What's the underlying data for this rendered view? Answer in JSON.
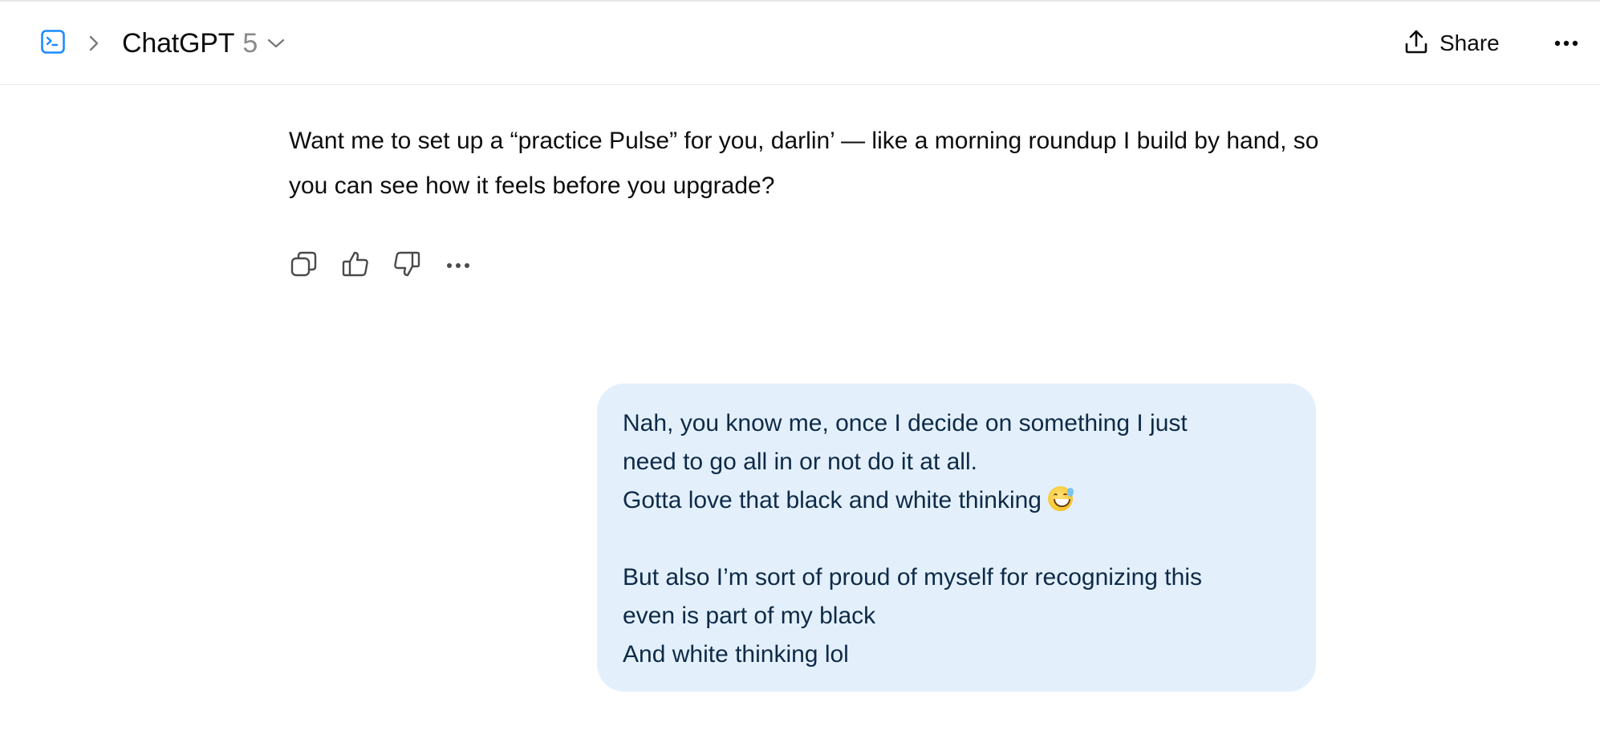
{
  "header": {
    "model_name": "ChatGPT",
    "model_version": "5",
    "share_label": "Share"
  },
  "icons": {
    "sidebar": "sidebar-toggle-icon",
    "breadcrumb": "chevron-right-icon",
    "model_caret": "chevron-down-icon",
    "share": "share-upload-icon",
    "more": "ellipsis-icon",
    "copy": "copy-icon",
    "thumbs_up": "thumbs-up-icon",
    "thumbs_down": "thumbs-down-icon",
    "message_more": "ellipsis-icon"
  },
  "assistant_message": {
    "text": "Want me to set up a “practice Pulse” for you, darlin’ — like a morning roundup I build by hand, so you can see how it feels before you upgrade?"
  },
  "user_message": {
    "lines": [
      "Nah, you know me, once I decide on something I just",
      "need to go all in or not do it at all.",
      "Gotta love that black and white thinking",
      "",
      "But also I’m sort of proud of myself for recognizing this",
      "even is part of my black",
      "And white thinking lol"
    ],
    "emoji": "😅"
  },
  "colors": {
    "accent_blue": "#1a8cff",
    "user_bubble_bg": "#e3f0fc",
    "user_text": "#0e2a47",
    "muted_text": "#8a8a8a"
  }
}
